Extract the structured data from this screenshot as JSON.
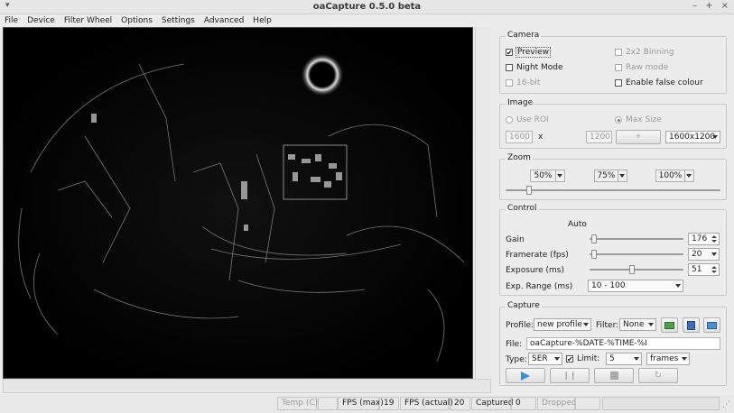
{
  "window": {
    "title": "oaCapture 0.5.0 beta",
    "controls": [
      "–",
      "+",
      "×"
    ]
  },
  "menu": [
    "File",
    "Device",
    "Filter Wheel",
    "Options",
    "Settings",
    "Advanced",
    "Help"
  ],
  "camera": {
    "title": "Camera",
    "preview": "Preview",
    "preview_checked": true,
    "night_mode": "Night Mode",
    "bit16": "16-bit",
    "binning": "2x2 Binning",
    "raw_mode": "Raw mode",
    "false_colour": "Enable false colour"
  },
  "image": {
    "title": "Image",
    "use_roi": "Use ROI",
    "max_size": "Max Size",
    "width": "1600",
    "x": "x",
    "height": "1200",
    "resolution": "1600x1200"
  },
  "zoom": {
    "title": "Zoom",
    "z50": "50%",
    "z75": "75%",
    "z100": "100%",
    "slider_fraction": 0.1
  },
  "control": {
    "title": "Control",
    "auto": "Auto",
    "gain_label": "Gain",
    "gain_value": "176",
    "gain_fraction": 0.02,
    "framerate_label": "Framerate (fps)",
    "framerate_value": "20",
    "framerate_fraction": 0.02,
    "exposure_label": "Exposure (ms)",
    "exposure_value": "51",
    "exposure_fraction": 0.45,
    "exp_range_label": "Exp. Range (ms)",
    "exp_range_value": "10 - 100"
  },
  "capture": {
    "title": "Capture",
    "profile_label": "Profile:",
    "profile_value": "new profile",
    "filter_label": "Filter:",
    "filter_value": "None",
    "file_label": "File:",
    "file_value": "oaCapture-%DATE-%TIME-%I",
    "type_label": "Type:",
    "type_value": "SER",
    "limit_label": "Limit:",
    "limit_checked": true,
    "limit_value": "5",
    "limit_unit": "frames"
  },
  "status": {
    "temp_label": "Temp (C)",
    "fps_max_label": "FPS (max)",
    "fps_max_value": "19",
    "fps_actual_label": "FPS (actual)",
    "fps_actual_value": "20",
    "captured_label": "Captured",
    "captured_value": "0",
    "dropped_label": "Dropped"
  },
  "colors": {
    "preview_bg": "#000000",
    "play_icon": "#3a8fd8"
  }
}
